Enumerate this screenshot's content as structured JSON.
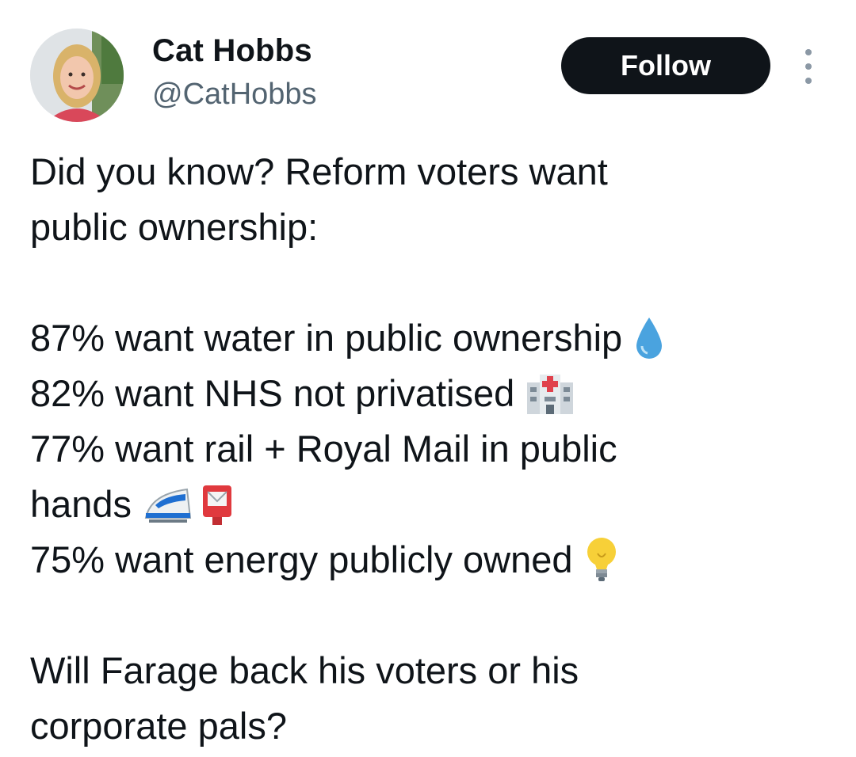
{
  "author": {
    "display_name": "Cat Hobbs",
    "handle": "@CatHobbs",
    "avatar_icon": "profile-photo"
  },
  "follow_button": {
    "label": "Follow"
  },
  "more_menu": {
    "icon": "more-vertical-icon"
  },
  "tweet": {
    "lines": [
      "Did you know? Reform voters want",
      "public ownership:",
      "87% want water in public ownership",
      "82% want NHS not privatised",
      "77% want rail + Royal Mail in public",
      "hands",
      "75% want energy publicly owned",
      "Will Farage back his voters or his",
      "corporate pals?"
    ],
    "emojis": {
      "water": "droplet-emoji",
      "nhs": "hospital-emoji",
      "rail": "bullet-train-emoji",
      "mail": "postbox-emoji",
      "energy": "light-bulb-emoji"
    }
  },
  "colors": {
    "text": "#0f1419",
    "secondary_text": "#536471",
    "button_bg": "#0f1419",
    "button_text": "#ffffff"
  }
}
